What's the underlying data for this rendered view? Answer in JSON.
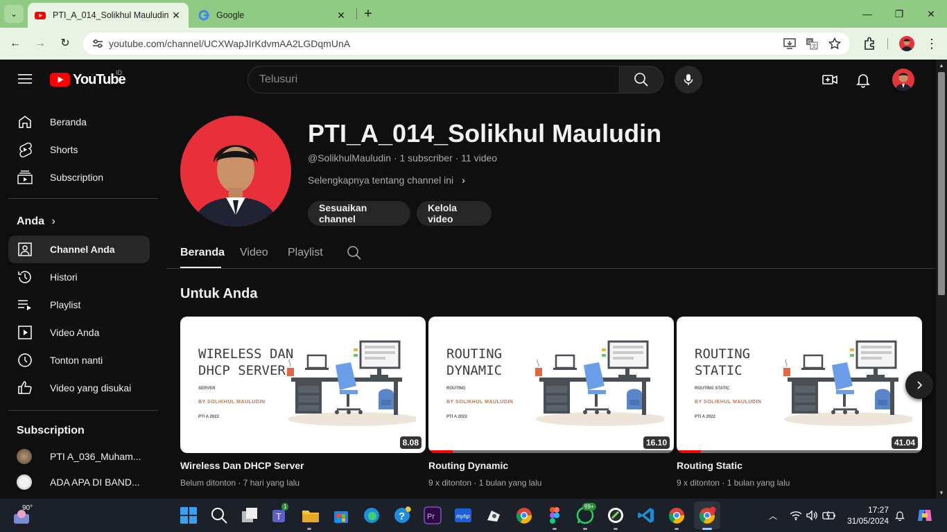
{
  "browser": {
    "tabs": [
      {
        "title": "PTI_A_014_Solikhul Mauludin -",
        "active": true
      },
      {
        "title": "Google",
        "active": false
      }
    ],
    "url": "youtube.com/channel/UCXWapJIrKdvmAA2LGDqmUnA"
  },
  "youtube": {
    "logo_text": "YouTube",
    "country_code": "ID",
    "search_placeholder": "Telusuri",
    "sidebar": {
      "main": [
        {
          "label": "Beranda",
          "icon": "home-icon"
        },
        {
          "label": "Shorts",
          "icon": "shorts-icon"
        },
        {
          "label": "Subscription",
          "icon": "subscriptions-icon"
        }
      ],
      "you_header": "Anda",
      "you_items": [
        {
          "label": "Channel Anda",
          "icon": "channel-icon",
          "selected": true
        },
        {
          "label": "Histori",
          "icon": "history-icon"
        },
        {
          "label": "Playlist",
          "icon": "playlist-icon"
        },
        {
          "label": "Video Anda",
          "icon": "your-videos-icon"
        },
        {
          "label": "Tonton nanti",
          "icon": "watch-later-icon"
        },
        {
          "label": "Video yang disukai",
          "icon": "like-icon"
        }
      ],
      "subs_header": "Subscription",
      "subs": [
        {
          "label": "PTI A_036_Muham..."
        },
        {
          "label": "ADA APA DI BAND..."
        }
      ]
    },
    "channel": {
      "name": "PTI_A_014_Solikhul Mauludin",
      "meta": "@SolikhulMauludin · 1 subscriber · 11 video",
      "more": "Selengkapnya tentang channel ini",
      "buttons": [
        "Sesuaikan channel",
        "Kelola video"
      ],
      "tabs": [
        "Beranda",
        "Video",
        "Playlist"
      ],
      "section_title": "Untuk Anda"
    },
    "videos": [
      {
        "thumb_lines": "WIRELESS DAN\nDHCP SERVER",
        "thumb_sub": "SERVER",
        "thumb_by": "BY SOLIKHUL MAULUDIN",
        "thumb_class": "PTI A 2022",
        "duration": "8.08",
        "progress": 0,
        "title": "Wireless Dan DHCP Server",
        "meta": "Belum ditonton · 7 hari yang lalu"
      },
      {
        "thumb_lines": "ROUTING\nDYNAMIC",
        "thumb_sub": "ROUTING",
        "thumb_by": "BY SOLIKHUL MAULUDIN",
        "thumb_class": "PTI A 2022",
        "duration": "16.10",
        "progress": 0.1,
        "title": "Routing Dynamic",
        "meta": "9 x ditonton · 1 bulan yang lalu"
      },
      {
        "thumb_lines": "ROUTING\nSTATIC",
        "thumb_sub": "ROUTING STATIC",
        "thumb_by": "BY SOLIKHUL MAULUDIN",
        "thumb_class": "PTI A 2022",
        "duration": "41.04",
        "progress": 0.1,
        "title": "Routing Static",
        "meta": "9 x ditonton · 1 bulan yang lalu"
      }
    ]
  },
  "taskbar": {
    "weather": "90°",
    "badges": {
      "teams": "1",
      "whatsapp": "99+"
    },
    "time": "17:27",
    "date": "31/05/2024"
  }
}
